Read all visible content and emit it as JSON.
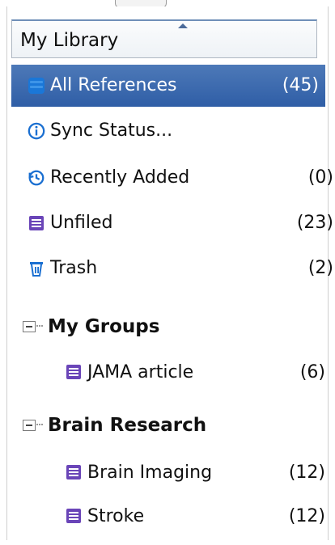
{
  "header": {
    "title": "My Library"
  },
  "library_items": [
    {
      "label": "All References",
      "count": "(45)",
      "icon": "database-icon",
      "selected": true
    },
    {
      "label": "Sync Status...",
      "count": "",
      "icon": "info-icon"
    },
    {
      "label": "Recently Added",
      "count": "(0)",
      "icon": "history-icon"
    },
    {
      "label": "Unfiled",
      "count": "(23)",
      "icon": "group-book-icon"
    },
    {
      "label": "Trash",
      "count": "(2)",
      "icon": "trash-icon"
    }
  ],
  "groups": [
    {
      "title": "My Groups",
      "items": [
        {
          "label": "JAMA article",
          "count": "(6)",
          "icon": "group-book-icon"
        }
      ]
    },
    {
      "title": "Brain Research",
      "items": [
        {
          "label": "Brain Imaging",
          "count": "(12)",
          "icon": "group-book-icon"
        },
        {
          "label": "Stroke",
          "count": "(12)",
          "icon": "group-book-icon"
        }
      ]
    }
  ],
  "colors": {
    "selected_bg": "#3b69ad",
    "accent_blue": "#1a6fd1",
    "icon_purple": "#6a45b8"
  }
}
